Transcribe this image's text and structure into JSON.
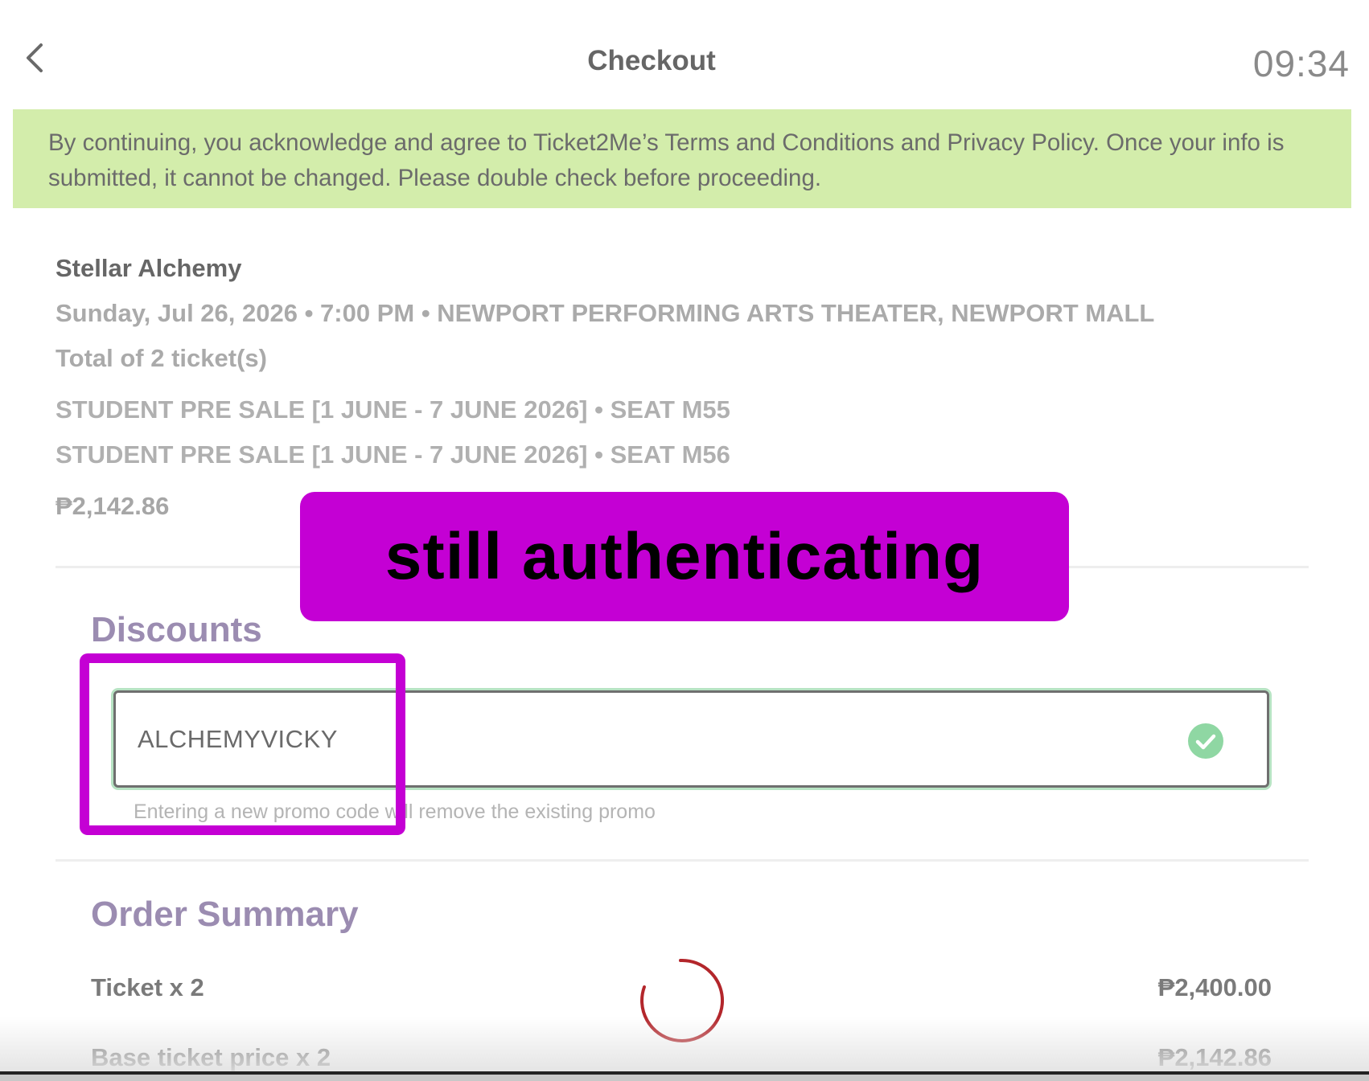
{
  "header": {
    "title": "Checkout",
    "timer": "09:34"
  },
  "notice": {
    "text": "By continuing, you acknowledge and agree to Ticket2Me’s Terms and Conditions and Privacy Policy. Once your info is submitted, it cannot be changed. Please double check before proceeding."
  },
  "event": {
    "name": "Stellar Alchemy",
    "meta": "Sunday, Jul 26, 2026 • 7:00 PM • NEWPORT PERFORMING ARTS THEATER, NEWPORT MALL",
    "ticket_total": "Total of 2 ticket(s)",
    "seats": [
      "STUDENT PRE SALE [1 JUNE - 7 JUNE 2026] • SEAT M55",
      "STUDENT PRE SALE [1 JUNE - 7 JUNE 2026] • SEAT M56"
    ],
    "price": "₱2,142.86"
  },
  "overlay": {
    "status_text": "still authenticating"
  },
  "discounts": {
    "heading": "Discounts",
    "promo_value": "ALCHEMYVICKY",
    "hint": "Entering a new promo code will remove the existing promo"
  },
  "order_summary": {
    "heading": "Order Summary",
    "rows": [
      {
        "label": "Ticket x 2",
        "value": "₱2,400.00"
      },
      {
        "label": "Base ticket price x 2",
        "value": "₱2,142.86"
      }
    ]
  },
  "colors": {
    "notice_bg": "#d3edab",
    "overlay_bg": "#c400d4",
    "heading": "#9b8cb1",
    "success": "#8fd7a3",
    "spinner": "#b3262b"
  },
  "icons": {
    "back": "chevron-left-icon",
    "promo_valid": "check-circle-icon",
    "loading": "spinner-icon"
  }
}
